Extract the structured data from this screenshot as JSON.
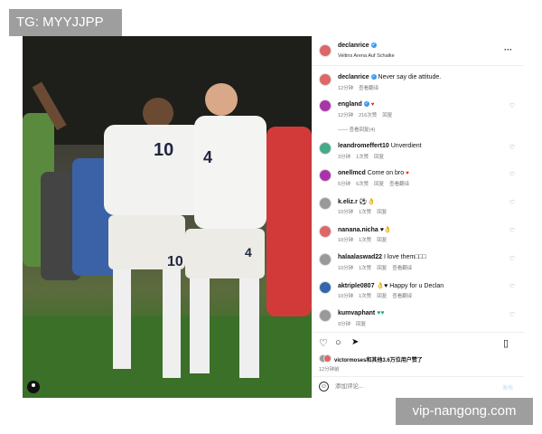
{
  "watermarks": {
    "top": "TG: MYYJJPP",
    "bottom": "vip-nangong.com"
  },
  "header": {
    "username": "declanrice",
    "location": "Veltins Arena Auf Schalke",
    "more": "···"
  },
  "caption": {
    "username": "declanrice",
    "text": "Never say die attitude.",
    "time": "12分钟",
    "translate": "查看翻译"
  },
  "comments": [
    {
      "username": "england",
      "badge": "✔",
      "emoji": "♥",
      "text": "",
      "time": "12分钟",
      "likes": "216次赞",
      "reply": "回复",
      "view_replies": "—— 查看回复(4)",
      "heart": "♡",
      "avatar_color": "purple"
    },
    {
      "username": "leandromeffert10",
      "text": "Unverdient",
      "time": "3分钟",
      "likes": "1次赞",
      "reply": "回复",
      "heart": "♡",
      "avatar_color": "green"
    },
    {
      "username": "onellmcd",
      "text": "Come on bro",
      "emoji": "♥",
      "time": "5分钟",
      "likes": "6次赞",
      "reply": "回复",
      "translate": "查看翻译",
      "heart": "♡",
      "avatar_color": "purple"
    },
    {
      "username": "k.eliz.r",
      "text": "⚽👌",
      "time": "10分钟",
      "likes": "1次赞",
      "reply": "回复",
      "heart": "♡",
      "avatar_color": "gray"
    },
    {
      "username": "nanana.nicha",
      "text": "♥👌",
      "time": "10分钟",
      "likes": "1次赞",
      "reply": "回复",
      "heart": "♡",
      "avatar_color": "red"
    },
    {
      "username": "halaalaswad22",
      "text": "I love them□□□",
      "time": "10分钟",
      "likes": "1次赞",
      "reply": "回复",
      "translate": "查看翻译",
      "heart": "♡",
      "avatar_color": "gray"
    },
    {
      "username": "aktriple0807",
      "text": "👌♥ Happy for u Declan",
      "time": "10分钟",
      "likes": "1次赞",
      "reply": "回复",
      "translate": "查看翻译",
      "heart": "♡",
      "avatar_color": "blue"
    },
    {
      "username": "kumvaphant",
      "text": "♥♥",
      "time": "9分钟",
      "reply": "回复",
      "heart": "♡",
      "avatar_color": "gray"
    }
  ],
  "actions": {
    "like": "♡",
    "comment": "○",
    "share": "➤",
    "save": "▯"
  },
  "likes_summary": "victormoses和其他3.6万位用户赞了",
  "post_time": "12分钟前",
  "add_comment": {
    "placeholder": "添加评论...",
    "send": "发布"
  },
  "photo_players": [
    {
      "number": "10"
    },
    {
      "number": "4"
    },
    {
      "number": "10"
    },
    {
      "number": "4"
    }
  ]
}
